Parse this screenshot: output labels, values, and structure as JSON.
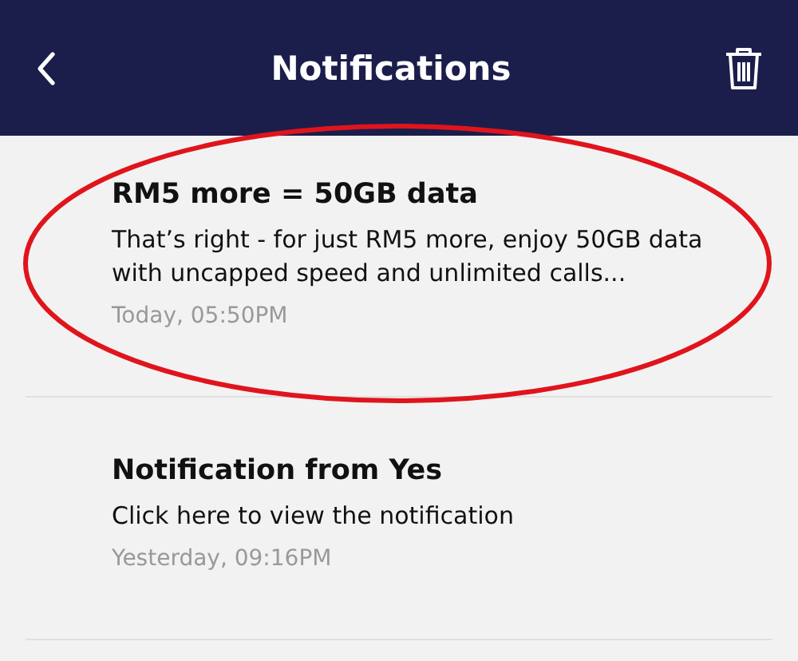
{
  "header": {
    "title": "Notifications"
  },
  "notifications": [
    {
      "title": "RM5 more = 50GB data",
      "body": "That’s right - for just RM5 more, enjoy 50GB data with uncapped speed and unlimited calls...",
      "time": "Today, 05:50PM",
      "circled": true
    },
    {
      "title": "Notification from Yes",
      "body": "Click here to view the notification",
      "time": "Yesterday, 09:16PM",
      "circled": false
    }
  ]
}
